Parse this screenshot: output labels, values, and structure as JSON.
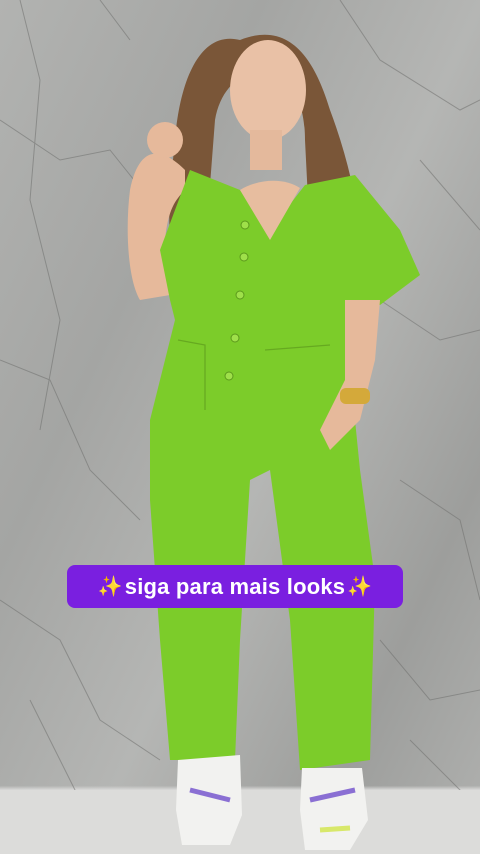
{
  "caption": {
    "text": "siga para mais looks",
    "leading_emoji": "✨",
    "trailing_emoji": "✨",
    "background_color": "#7a1fe0",
    "text_color": "#ffffff"
  },
  "photo": {
    "outfit_color": "#7ccc2a",
    "wall_color": "#a8a9a7"
  }
}
